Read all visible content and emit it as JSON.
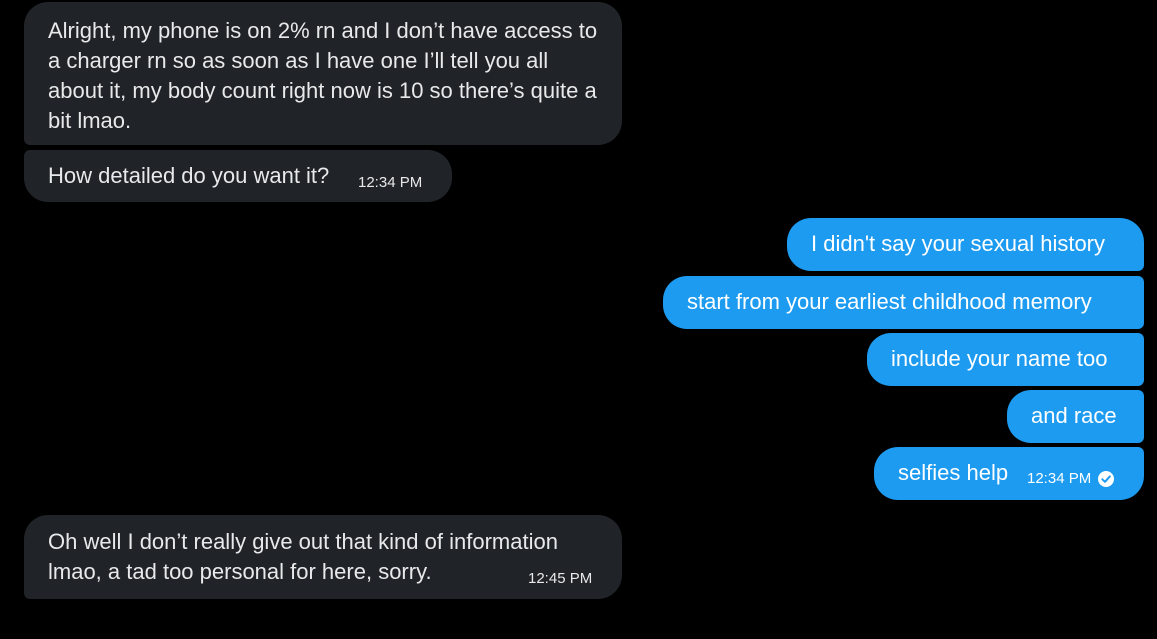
{
  "conversation": {
    "messages": [
      {
        "direction": "incoming",
        "text": "Alright, my phone is on 2% rn and I don’t have access to a charger rn so as soon as I have one I’ll tell you all about it, my body count right now is 10 so there’s quite a bit lmao."
      },
      {
        "direction": "incoming",
        "text": "How detailed do you want it?",
        "time": "12:34 PM"
      },
      {
        "direction": "outgoing",
        "text": "I didn't say your sexual history"
      },
      {
        "direction": "outgoing",
        "text": "start from your earliest childhood memory"
      },
      {
        "direction": "outgoing",
        "text": "include your name too"
      },
      {
        "direction": "outgoing",
        "text": "and race"
      },
      {
        "direction": "outgoing",
        "text": "selfies help",
        "time": "12:34 PM",
        "status_icon": "read-check-icon"
      },
      {
        "direction": "incoming",
        "text": "Oh well I don’t really give out that kind of information lmao, a tad too personal for here, sorry.",
        "time": "12:45 PM"
      }
    ]
  },
  "colors": {
    "background": "#000000",
    "incoming_bubble": "#202327",
    "outgoing_bubble": "#1d9bf0",
    "incoming_text": "#e7e9ea",
    "outgoing_text": "#ffffff"
  }
}
